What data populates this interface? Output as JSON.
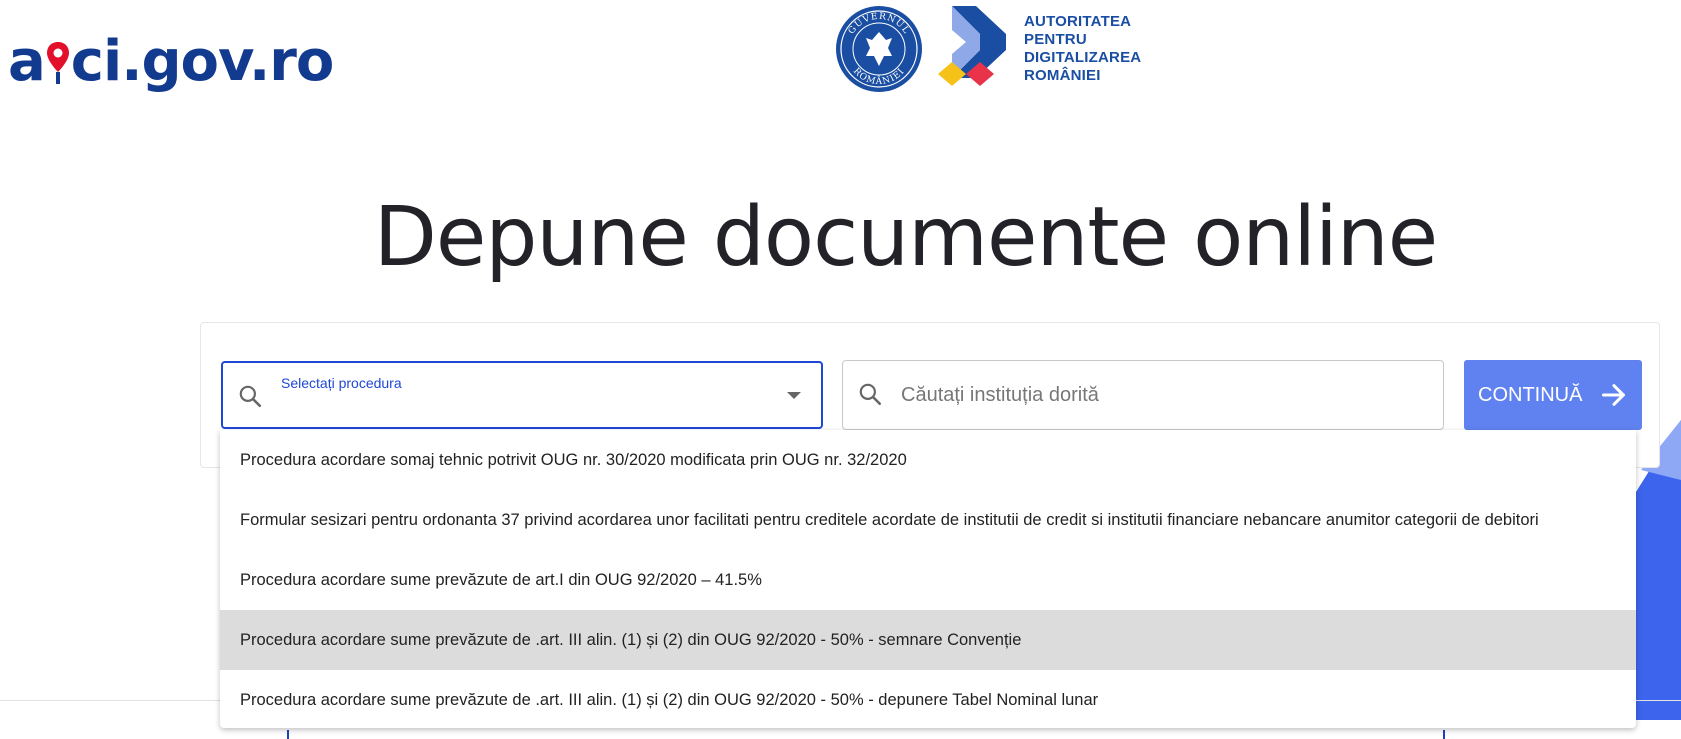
{
  "header": {
    "brand_before": "a",
    "brand_after": "ci.gov.ro",
    "gov_seal_text_top": "GUVERNUL",
    "gov_seal_text_bottom": "ROMÂNIEI",
    "authority_lines": [
      "AUTORITATEA",
      "PENTRU",
      "DIGITALIZAREA",
      "ROMÂNIEI"
    ]
  },
  "main": {
    "title": "Depune documente online"
  },
  "search": {
    "procedure_label": "Selectați procedura",
    "institution_placeholder": "Căutați instituția dorită",
    "institution_value": "",
    "continue_label": "CONTINUĂ"
  },
  "dropdown": {
    "highlighted_index": 3,
    "options": [
      {
        "label": "Procedura acordare somaj tehnic potrivit OUG nr. 30/2020 modificata prin OUG nr. 32/2020"
      },
      {
        "label": "Formular sesizari pentru ordonanta 37 privind acordarea unor facilitati pentru creditele acordate de institutii de credit si institutii financiare nebancare anumitor categorii de debitori"
      },
      {
        "label": "Procedura acordare sume prevăzute de art.I din OUG 92/2020 – 41.5%"
      },
      {
        "label": "Procedura acordare sume prevăzute de .art. III alin. (1) și (2) din OUG 92/2020 - 50% - semnare Convenție"
      },
      {
        "label": "Procedura acordare sume prevăzute de .art. III alin. (1) și (2) din OUG 92/2020 - 50% - depunere Tabel Nominal lunar"
      }
    ]
  },
  "colors": {
    "brand": "#123a8f",
    "pin": "#e2102a",
    "accent": "#1f47d6",
    "button": "#5f82f0",
    "highlight": "#dcdcdc"
  },
  "icons": {
    "field_search": "search-icon",
    "dropdown_caret": "chevron-down-icon",
    "button_arrow": "arrow-right-icon"
  }
}
